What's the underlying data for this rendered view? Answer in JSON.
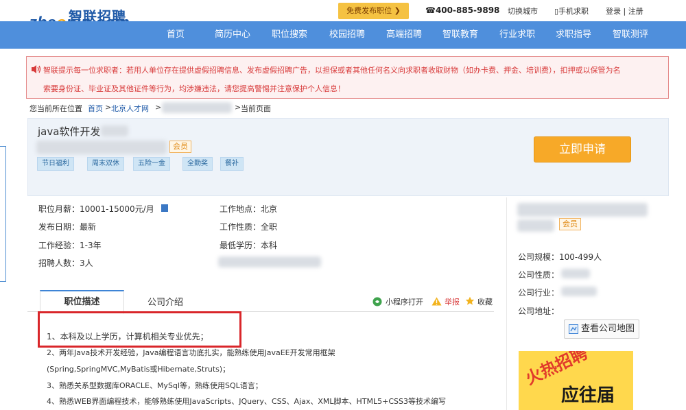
{
  "logo": {
    "zh": "智联招聘",
    "en_a": "zha",
    "en_dot": "o",
    "en_b": "pin.com"
  },
  "topbar": {
    "promo": "免费发布职位 ❯",
    "hotline": "☎400-885-9898",
    "city": "切换城市",
    "mobile": "▯手机求职",
    "login": "登录 | 注册"
  },
  "nav": [
    "首页",
    "简历中心",
    "职位搜索",
    "校园招聘",
    "高端招聘",
    "智联教育",
    "行业求职",
    "求职指导",
    "智联测评"
  ],
  "notice": {
    "line1": "智联提示每一位求职者：若用人单位存在提供虚假招聘信息、发布虚假招聘广告，以担保或者其他任何名义向求职者收取财物（如办卡费、押金、培训费），扣押或以保管为名",
    "line2": "索要身份证、毕业证及其他证件等行为，均涉嫌违法，请您提高警惕并注意保护个人信息！"
  },
  "breadcrumb": {
    "prefix": "您当前所在位置",
    "home": "首页",
    "sep": ">",
    "city": "北京人才网",
    "current": "当前页面"
  },
  "job": {
    "title": "java软件开发",
    "member": "会员",
    "tags": [
      "节日福利",
      "周末双休",
      "五险一金",
      "全勤奖",
      "餐补"
    ],
    "apply": "立即申请"
  },
  "info": {
    "salary": "职位月薪：10001-15000元/月",
    "date": "发布日期：最新",
    "experience": "工作经验：1-3年",
    "headcount": "招聘人数：3人",
    "location": "工作地点：北京",
    "nature": "工作性质：全职",
    "education": "最低学历：本科"
  },
  "tabs": {
    "active": "职位描述",
    "other": "公司介绍"
  },
  "tools": {
    "mini": "小程序打开",
    "report": "举报",
    "fav": "收藏"
  },
  "description": [
    "1、本科及以上学历，计算机相关专业优先；",
    "2、两年Java技术开发经验，Java编程语言功底扎实，能熟练使用JavaEE开发常用框架",
    "(Spring,SpringMVC,MyBatis或Hibernate,Struts)；",
    "3、熟悉关系型数据库ORACLE、MySql等，熟练使用SQL语言；",
    "4、熟悉WEB界面编程技术，能够熟练使用JavaScripts、JQuery、CSS、Ajax、XML脚本、HTML5+CSS3等技术编写"
  ],
  "company": {
    "member": "会员",
    "size": "公司规模：100-499人",
    "nature": "公司性质：",
    "industry": "公司行业：",
    "address": "公司地址：",
    "map": "查看公司地图"
  },
  "ad": {
    "hot": "火热招聘",
    "main": "应往届"
  },
  "colors": {
    "nav": "#4f8fdc",
    "apply": "#f7a928",
    "notice": "#d83b3b",
    "highlight": "#d9262a"
  }
}
